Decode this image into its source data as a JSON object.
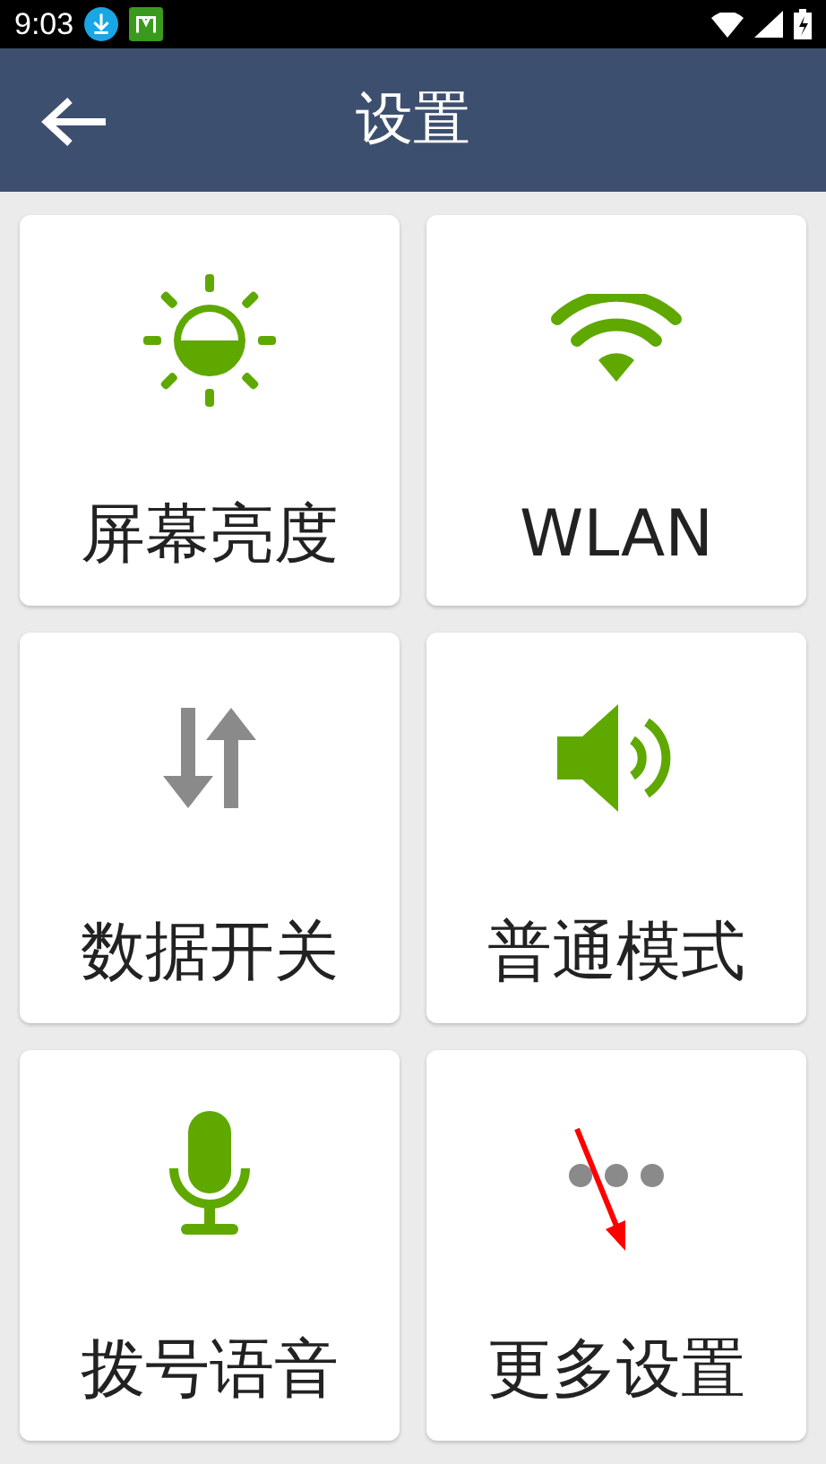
{
  "status_bar": {
    "time": "9:03"
  },
  "header": {
    "title": "设置"
  },
  "tiles": [
    {
      "kind": "brightness",
      "label": "屏幕亮度",
      "on": true
    },
    {
      "kind": "wifi",
      "label": "WLAN",
      "on": true
    },
    {
      "kind": "data",
      "label": "数据开关",
      "on": false
    },
    {
      "kind": "sound",
      "label": "普通模式",
      "on": true
    },
    {
      "kind": "mic",
      "label": "拨号语音",
      "on": true
    },
    {
      "kind": "more",
      "label": "更多设置",
      "on": false
    }
  ]
}
